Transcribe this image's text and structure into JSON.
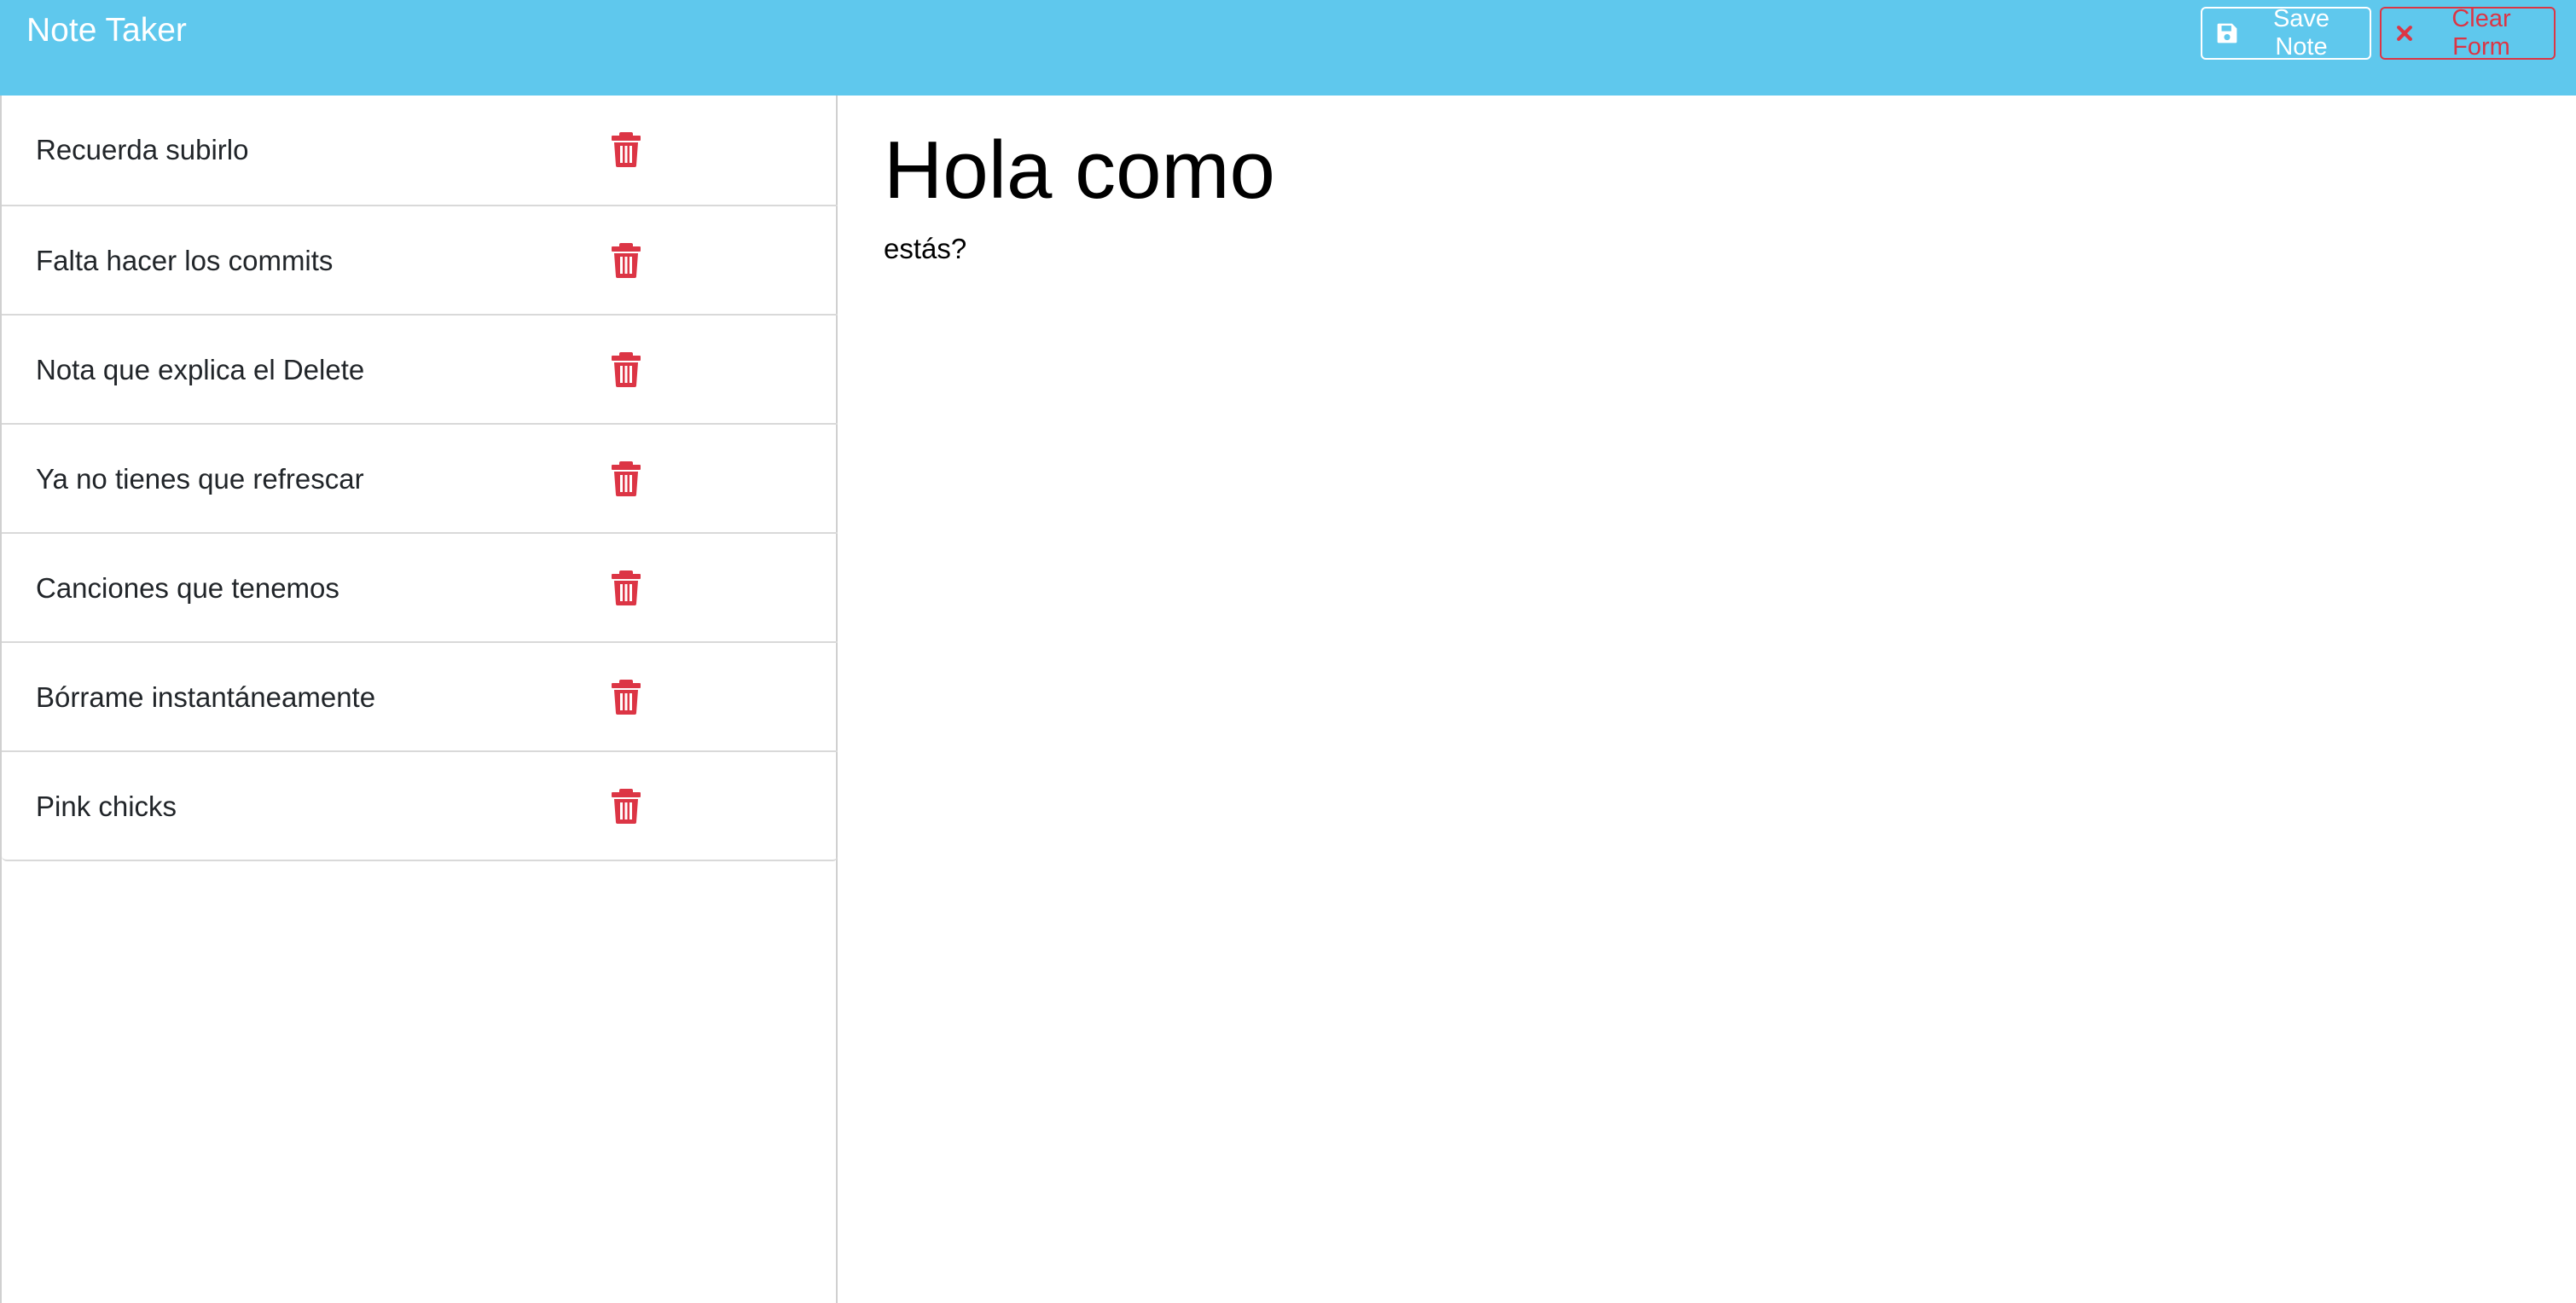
{
  "header": {
    "brand": "Note Taker",
    "save_label": "Save Note",
    "clear_label": "Clear Form"
  },
  "notes": [
    {
      "title": "Recuerda subirlo"
    },
    {
      "title": "Falta hacer los commits"
    },
    {
      "title": "Nota que explica el Delete"
    },
    {
      "title": "Ya no tienes que refrescar"
    },
    {
      "title": "Canciones que tenemos"
    },
    {
      "title": "Bórrame instantáneamente"
    },
    {
      "title": "Pink chicks"
    }
  ],
  "active_note": {
    "title": "Hola como",
    "text": "estás?"
  },
  "colors": {
    "navbar": "#5fc8ed",
    "danger": "#dc3545",
    "text": "#212529"
  },
  "icons": {
    "save": "floppy-disk-icon",
    "clear": "close-icon",
    "delete": "trash-icon"
  }
}
